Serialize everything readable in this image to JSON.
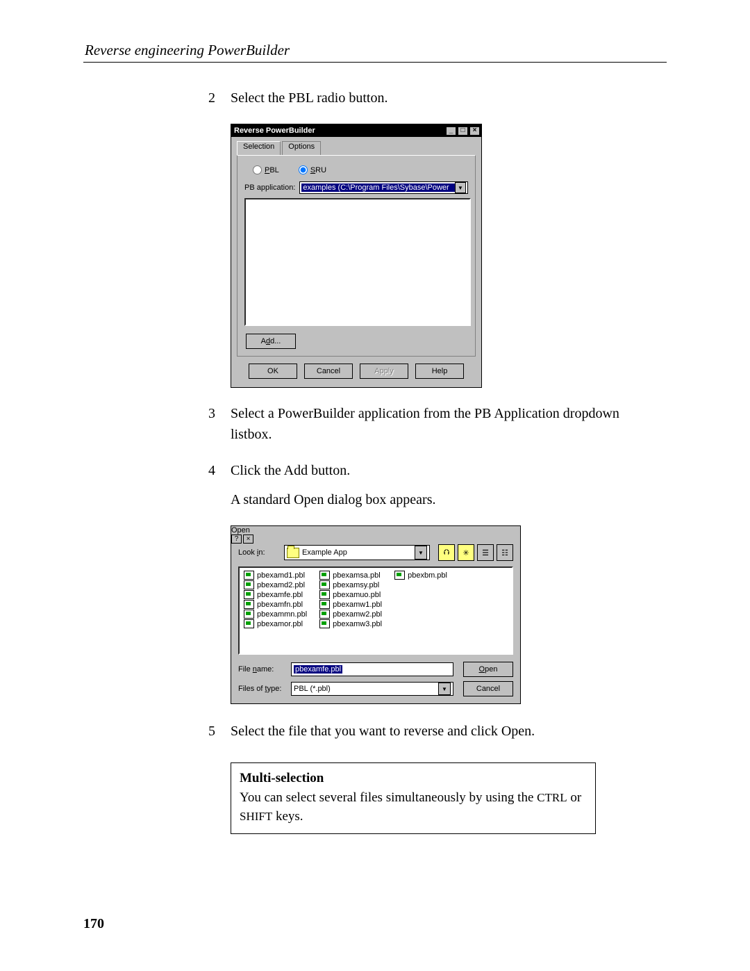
{
  "header": "Reverse engineering PowerBuilder",
  "page_number": "170",
  "steps": {
    "s2": {
      "num": "2",
      "text": "Select the PBL radio button."
    },
    "s3": {
      "num": "3",
      "text": "Select a PowerBuilder application from the PB Application dropdown listbox."
    },
    "s4": {
      "num": "4",
      "text": "Click the Add button.",
      "follow": "A standard Open dialog box appears."
    },
    "s5": {
      "num": "5",
      "text": "Select the file that you want to reverse and click Open."
    }
  },
  "dialog1": {
    "title": "Reverse PowerBuilder",
    "tabs": {
      "selection": "Selection",
      "options": "Options"
    },
    "radio_pbl": "PBL",
    "radio_sru": "SRU",
    "pbapp_label": "PB application:",
    "pbapp_value": "examples (C:\\Program Files\\Sybase\\Power",
    "add": "Add...",
    "ok": "OK",
    "cancel": "Cancel",
    "apply": "Apply",
    "help": "Help"
  },
  "dialog2": {
    "title": "Open",
    "lookin_label": "Look in:",
    "lookin_value": "Example App",
    "files_col1": [
      "pbexamd1.pbl",
      "pbexamd2.pbl",
      "pbexamfe.pbl",
      "pbexamfn.pbl",
      "pbexammn.pbl",
      "pbexamor.pbl"
    ],
    "files_col2": [
      "pbexamsa.pbl",
      "pbexamsy.pbl",
      "pbexamuo.pbl",
      "pbexamw1.pbl",
      "pbexamw2.pbl",
      "pbexamw3.pbl"
    ],
    "files_col3": [
      "pbexbm.pbl"
    ],
    "filename_label": "File name:",
    "filename_value": "pbexamfe.pbl",
    "filetype_label": "Files of type:",
    "filetype_value": "PBL (*.pbl)",
    "open": "Open",
    "cancel": "Cancel"
  },
  "note": {
    "title": "Multi-selection",
    "body_pre": "You can select several files simultaneously by using the ",
    "ctrl": "CTRL",
    "or": " or ",
    "shift": "SHIFT",
    "body_post": " keys."
  }
}
